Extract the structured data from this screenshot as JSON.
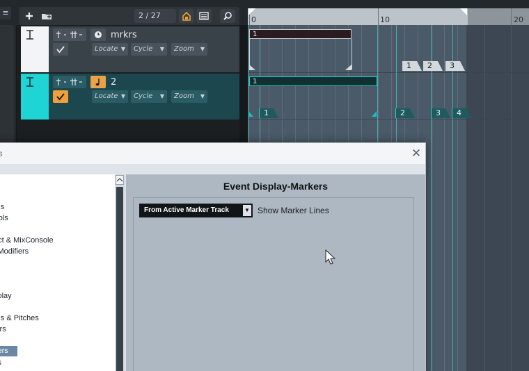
{
  "toolbar": {
    "menu_label": "≡",
    "add_icon": "plus-icon",
    "folder_icon": "add-folder-icon",
    "counter": "2 / 27",
    "snap_icon": "home-icon",
    "list_icon": "list-icon",
    "search_icon": "search-icon"
  },
  "tracks": [
    {
      "name": "mrkrs",
      "type_icon": "clock-icon",
      "locate": "Locate",
      "cycle": "Cycle",
      "zoom": "Zoom",
      "active": false
    },
    {
      "name": "2",
      "type_icon": "note-icon",
      "locate": "Locate",
      "cycle": "Cycle",
      "zoom": "Zoom",
      "active": true
    }
  ],
  "ruler": {
    "labels": [
      "0",
      "10",
      "20"
    ]
  },
  "events": {
    "track1_cycle": "1",
    "track1_markers": [
      "1",
      "2",
      "3"
    ],
    "track2_cycle": "1",
    "track2_markers": [
      "1",
      "2",
      "3",
      "4"
    ]
  },
  "dialog": {
    "title": "es",
    "close": "✕",
    "tree_items": [
      {
        "label": "io",
        "selected": false
      },
      {
        "label": "rds",
        "selected": false
      },
      {
        "label": "trols",
        "selected": false
      },
      {
        "label": "o|",
        "selected": false
      },
      {
        "label": "ect & MixConsole",
        "selected": false
      },
      {
        "label": "l Modifiers",
        "selected": false
      },
      {
        "label": "ls",
        "selected": false
      },
      {
        "label": "m",
        "selected": false
      },
      {
        "label": "",
        "selected": false
      },
      {
        "label": "splay",
        "selected": false
      },
      {
        "label": "io",
        "selected": false
      },
      {
        "label": "rds & Pitches",
        "selected": false
      },
      {
        "label": "lers",
        "selected": false
      },
      {
        "label": "o|",
        "selected": false
      },
      {
        "label": "kers",
        "selected": true
      },
      {
        "label": "ks",
        "selected": false
      }
    ],
    "panel_title": "Event Display-Markers",
    "marker_source_value": "From Active Marker Track",
    "marker_lines_label": "Show Marker Lines"
  },
  "colors": {
    "accent_cyan": "#1fd4d4",
    "check_orange": "#f0a03a",
    "selected_item": "#6c87a4"
  }
}
